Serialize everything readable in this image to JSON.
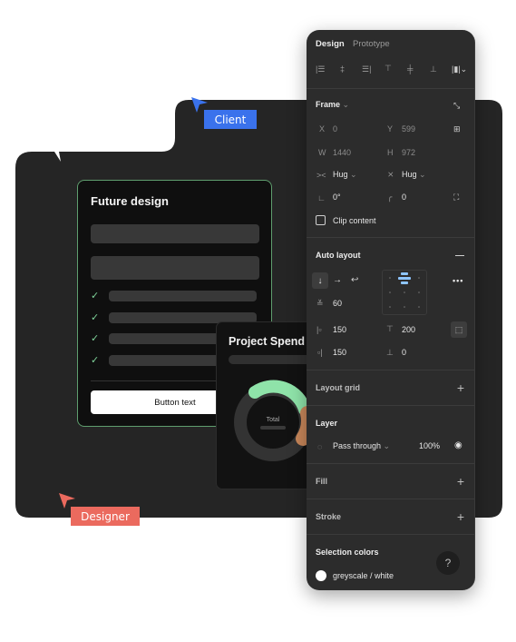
{
  "cursors": {
    "client": {
      "label": "Client",
      "color": "#3a72ec"
    },
    "designer": {
      "label": "Designer",
      "color": "#eb6a5e"
    }
  },
  "future_card": {
    "title": "Future design",
    "accent": "#7fd39a",
    "checklist_count": 4,
    "check_icon": "✓",
    "button_label": "Button text"
  },
  "spend_card": {
    "title": "Project Spend",
    "center_label": "Total",
    "segments": [
      {
        "name": "green",
        "color": "#8fe3a9"
      },
      {
        "name": "orange",
        "color": "#c9875a"
      }
    ]
  },
  "panel": {
    "tabs": [
      {
        "label": "Design",
        "active": true
      },
      {
        "label": "Prototype",
        "active": false
      }
    ],
    "align_icons": [
      "align-left",
      "align-horizontal-center",
      "align-right",
      "align-top",
      "align-vertical-center",
      "align-bottom",
      "distribute"
    ],
    "frame": {
      "title": "Frame",
      "x_label": "X",
      "x": "0",
      "y_label": "Y",
      "y": "599",
      "w_label": "W",
      "w": "1440",
      "h_label": "H",
      "h": "972",
      "hsize": "Hug",
      "vsize": "Hug",
      "rotation": "0°",
      "radius": "0",
      "clip_content": "Clip content"
    },
    "auto_layout": {
      "title": "Auto layout",
      "gap": "60",
      "pad_left": "150",
      "pad_top": "200",
      "pad_right": "150",
      "pad_bottom": "0",
      "direction_selected": "vertical"
    },
    "layout_grid": {
      "title": "Layout grid"
    },
    "layer": {
      "title": "Layer",
      "blend": "Pass through",
      "opacity": "100%"
    },
    "fill": {
      "title": "Fill"
    },
    "stroke": {
      "title": "Stroke"
    },
    "selection_colors": {
      "title": "Selection colors",
      "items": [
        {
          "name": "greyscale / white",
          "color": "#ffffff"
        }
      ]
    },
    "help": "?"
  }
}
